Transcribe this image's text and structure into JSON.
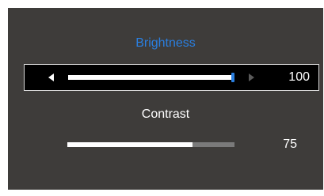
{
  "settings": {
    "brightness": {
      "label": "Brightness",
      "value": "100",
      "level": 1.0,
      "selected": true
    },
    "contrast": {
      "label": "Contrast",
      "value": "75",
      "level": 0.75,
      "selected": false
    }
  },
  "icons": {
    "decrease": "left-arrow-icon",
    "increase": "right-arrow-icon"
  },
  "colors": {
    "background": "#3e3c3a",
    "accent": "#2a7fe0",
    "fill": "#ffffff",
    "track": "#7a7a7a",
    "selected_row": "#000000"
  }
}
